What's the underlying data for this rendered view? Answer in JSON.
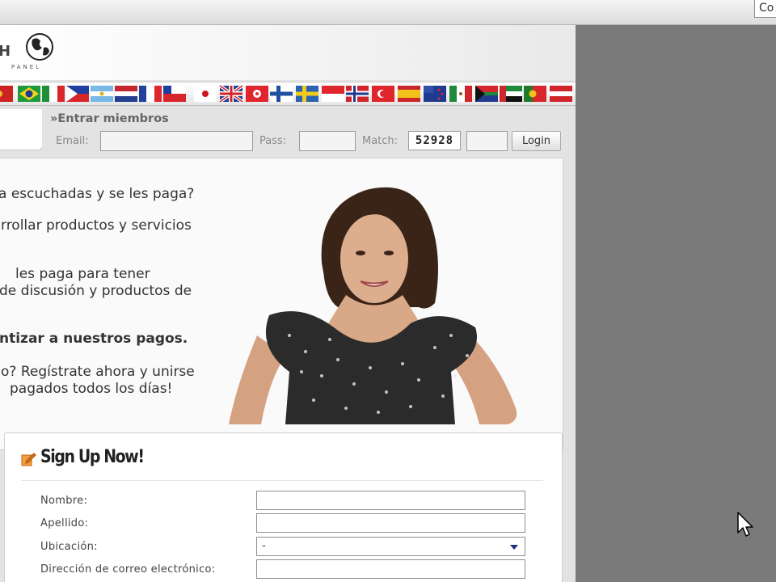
{
  "browser": {
    "address_fragment": "Co"
  },
  "site": {
    "logo_letter": "H",
    "logo_subtext": "PANEL"
  },
  "flags": {
    "items": [
      {
        "name": "flag-portugal-partial"
      },
      {
        "name": "flag-brazil"
      },
      {
        "name": "flag-italy"
      },
      {
        "name": "flag-philippines"
      },
      {
        "name": "flag-argentina"
      },
      {
        "name": "flag-netherlands"
      },
      {
        "name": "flag-france"
      },
      {
        "name": "flag-chile"
      },
      {
        "name": "flag-japan"
      },
      {
        "name": "flag-united-kingdom"
      },
      {
        "name": "flag-hong-kong"
      },
      {
        "name": "flag-finland"
      },
      {
        "name": "flag-sweden"
      },
      {
        "name": "flag-indonesia"
      },
      {
        "name": "flag-norway"
      },
      {
        "name": "flag-turkey"
      },
      {
        "name": "flag-spain"
      },
      {
        "name": "flag-new-zealand"
      },
      {
        "name": "flag-mexico"
      },
      {
        "name": "flag-south-africa"
      },
      {
        "name": "flag-uae"
      },
      {
        "name": "flag-portugal"
      },
      {
        "name": "flag-austria"
      }
    ]
  },
  "login": {
    "title": "»Entrar miembros",
    "email_label": "Email:",
    "pass_label": "Pass:",
    "match_label": "Match:",
    "match_code": "52928",
    "login_button": "Login"
  },
  "hero": {
    "lines": [
      "a escuchadas y se les paga?",
      "rrollar productos y servicios",
      "les paga para tener",
      "de discusión y productos de",
      "ntizar a nuestros pagos.",
      "o? Regístrate ahora y unirse",
      "pagados todos los días!"
    ]
  },
  "signup": {
    "title": "Sign Up Now!",
    "fields": {
      "first_name_label": "Nombre:",
      "last_name_label": "Apellido:",
      "location_label": "Ubicación:",
      "location_value": "-",
      "email_label": "Dirección de correo electrónico:"
    }
  },
  "colors": {
    "accent_orange": "#e8741a",
    "select_caret": "#1f2f7a"
  }
}
